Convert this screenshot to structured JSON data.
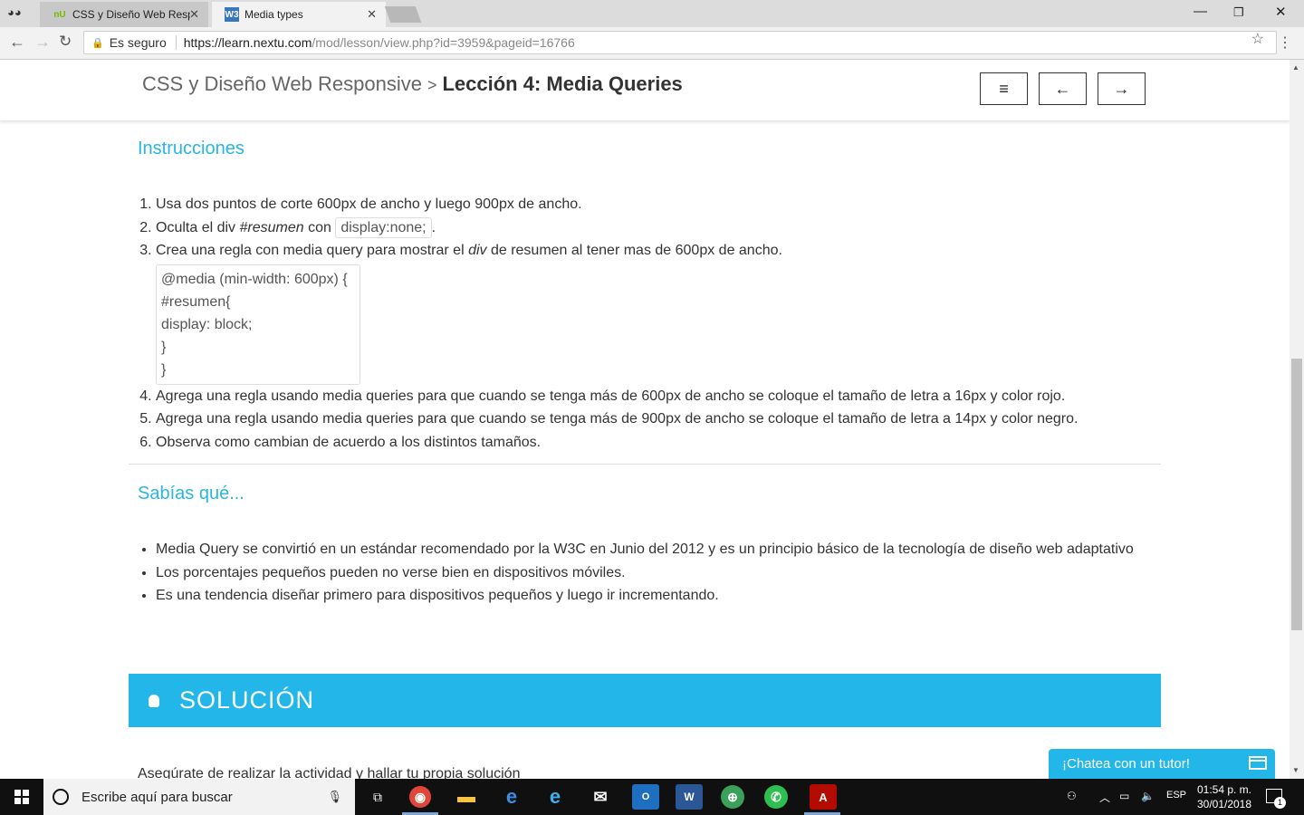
{
  "browser": {
    "tabs": [
      {
        "favicon": "nU",
        "title": "CSS y Diseño Web Respo",
        "active": false
      },
      {
        "favicon": "W3",
        "title": "Media types",
        "active": true
      }
    ],
    "security_label": "Es seguro",
    "url_host": "https://learn.nextu.com",
    "url_path": "/mod/lesson/view.php?id=3959&pageid=16766"
  },
  "header": {
    "course": "CSS y Diseño Web Responsive",
    "separator": ">",
    "lesson": "Lección 4: Media Queries",
    "buttons": {
      "menu": "≡",
      "prev": "←",
      "next": "→"
    }
  },
  "instructions": {
    "heading": "Instrucciones",
    "step1": "Usa dos puntos de corte 600px de ancho y luego 900px de ancho.",
    "step2_pre": "Oculta el div ",
    "step2_em": "#resumen",
    "step2_mid": " con ",
    "step2_code": "display:none;",
    "step2_post": ".",
    "step3_pre": "Crea una regla con media query para mostrar el ",
    "step3_em": "div",
    "step3_post": " de resumen al tener mas de 600px de ancho.",
    "code_block": "@media (min-width: 600px) {\n#resumen{\ndisplay: block;\n}\n}",
    "step4": "Agrega una regla usando media queries para que cuando se tenga más de 600px de ancho se coloque el tamaño de letra a 16px y color rojo.",
    "step5": "Agrega una regla usando media queries para que cuando se tenga más de 900px de ancho se coloque el tamaño de letra a 14px y color negro.",
    "step6": "Observa como cambian de acuerdo a los distintos tamaños."
  },
  "facts": {
    "heading": "Sabías qué...",
    "items": [
      "Media Query se convirtió en un estándar recomendado por la W3C en Junio del 2012 y es un principio básico de la tecnología de diseño web adaptativo",
      "Los porcentajes pequeños pueden no verse bien en dispositivos móviles.",
      "Es una tendencia diseñar primero para dispositivos pequeños y luego ir incrementando."
    ]
  },
  "solution": {
    "title": "SOLUCIÓN",
    "text": "Asegúrate de realizar la actividad y hallar tu propia solución"
  },
  "chat": {
    "label": "¡Chatea con un tutor!"
  },
  "taskbar": {
    "search_placeholder": "Escribe aquí para buscar",
    "language": "ESP",
    "time": "01:54 p. m.",
    "date": "30/01/2018",
    "notifications": "1"
  },
  "colors": {
    "accent": "#23b6e8",
    "heading": "#29b6e0",
    "text": "#333333"
  }
}
